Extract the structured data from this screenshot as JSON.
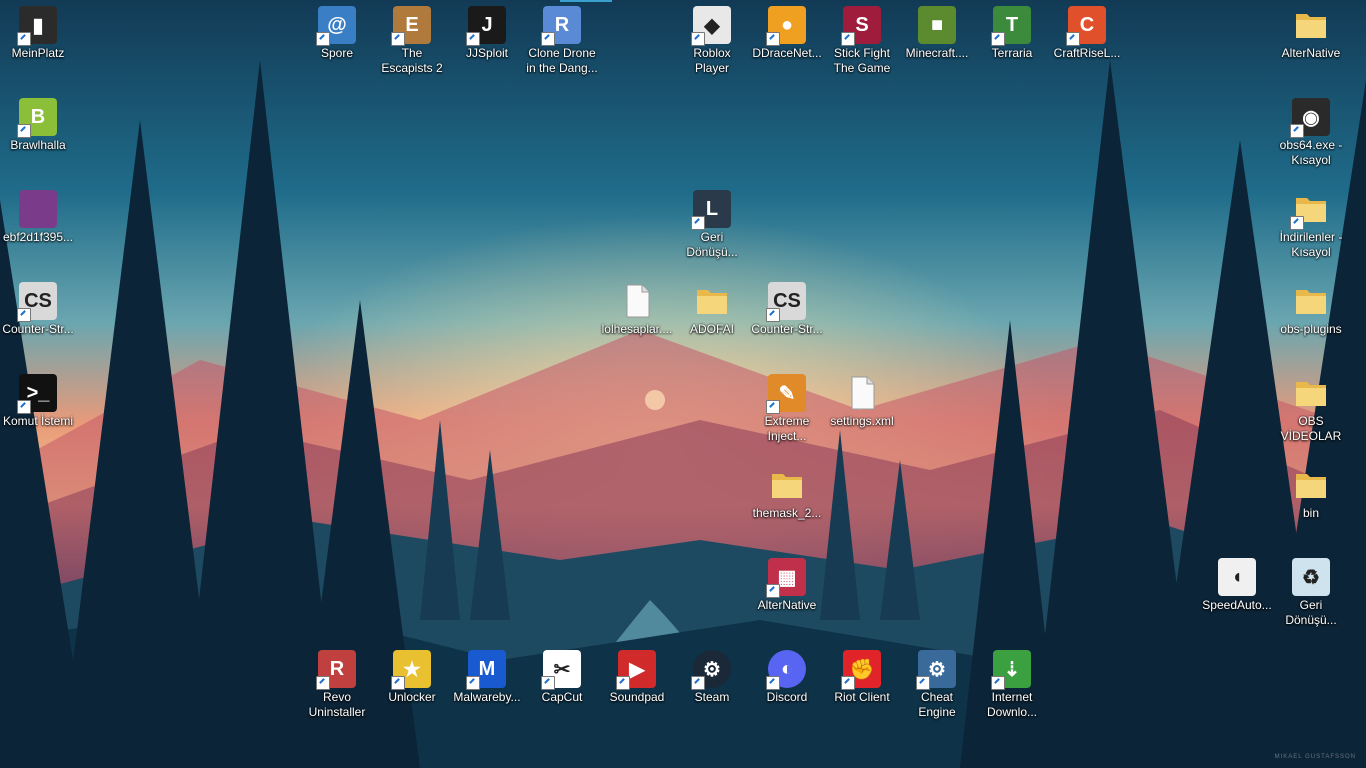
{
  "desktop": {
    "icons": [
      {
        "label": "MeinPlatz",
        "glyph": "▮",
        "color": "#2b2b2b",
        "shortcut": true
      },
      {
        "label": "Brawlhalla",
        "glyph": "B",
        "color": "#8bbf3a",
        "shortcut": true
      },
      {
        "label": "ebf2d1f395...",
        "glyph": "",
        "color": "#7a3c8a",
        "shortcut": false
      },
      {
        "label": "Counter-Str...",
        "glyph": "CS",
        "color": "#d9d9d9",
        "shortcut": true
      },
      {
        "label": "Komut İstemi",
        "glyph": ">_",
        "color": "#111111",
        "shortcut": true
      },
      {
        "label": "Spore",
        "glyph": "@",
        "color": "#3a7fc6",
        "shortcut": true
      },
      {
        "label": "The Escapists 2",
        "glyph": "E",
        "color": "#b07a3c",
        "shortcut": true
      },
      {
        "label": "JJSploit",
        "glyph": "J",
        "color": "#1a1a1a",
        "shortcut": true
      },
      {
        "label": "Clone Drone in the Dang...",
        "glyph": "R",
        "color": "#5a8ad6",
        "shortcut": true
      },
      {
        "label": "Roblox Player",
        "glyph": "◆",
        "color": "#e8e8e8",
        "shortcut": true
      },
      {
        "label": "DDraceNet...",
        "glyph": "●",
        "color": "#f0a020",
        "shortcut": true
      },
      {
        "label": "Stick Fight The Game",
        "glyph": "S",
        "color": "#a01c3c",
        "shortcut": true
      },
      {
        "label": "Minecraft....",
        "glyph": "■",
        "color": "#5c8a2e",
        "shortcut": false
      },
      {
        "label": "Terraria",
        "glyph": "T",
        "color": "#3c8a3c",
        "shortcut": true
      },
      {
        "label": "CraftRiseL...",
        "glyph": "C",
        "color": "#e0502a",
        "shortcut": true
      },
      {
        "label": "AlterNative",
        "glyph": "",
        "color": "#f2d27a",
        "shortcut": false
      },
      {
        "label": "obs64.exe - Kısayol",
        "glyph": "◉",
        "color": "#2a2a2a",
        "shortcut": true
      },
      {
        "label": "İndirilenler - Kısayol",
        "glyph": "↓",
        "color": "#f2d27a",
        "shortcut": true
      },
      {
        "label": "obs-plugins",
        "glyph": "",
        "color": "#f2d27a",
        "shortcut": false
      },
      {
        "label": "OBS VİDEOLAR",
        "glyph": "",
        "color": "#f2d27a",
        "shortcut": false
      },
      {
        "label": "bin",
        "glyph": "",
        "color": "#f2d27a",
        "shortcut": false
      },
      {
        "label": "SpeedAuto...",
        "glyph": "◖",
        "color": "#f0f0f0",
        "shortcut": false
      },
      {
        "label": "Geri Dönüşü...",
        "glyph": "♻",
        "color": "#cfe3ef",
        "shortcut": false
      },
      {
        "label": "Geri Dönüşü...",
        "glyph": "L",
        "color": "#2a3a4a",
        "shortcut": true
      },
      {
        "label": "lolhesaplar....",
        "glyph": "≡",
        "color": "#f4f4f4",
        "shortcut": false
      },
      {
        "label": "ADOFAI",
        "glyph": "",
        "color": "#f2d27a",
        "shortcut": false
      },
      {
        "label": "Counter-Str...",
        "glyph": "CS",
        "color": "#d9d9d9",
        "shortcut": true
      },
      {
        "label": "Extreme Inject...",
        "glyph": "✎",
        "color": "#e08a2a",
        "shortcut": true
      },
      {
        "label": "settings.xml",
        "glyph": "",
        "color": "#f4f4f4",
        "shortcut": false
      },
      {
        "label": "themask_2...",
        "glyph": "",
        "color": "#f2d27a",
        "shortcut": false
      },
      {
        "label": "AlterNative",
        "glyph": "▦",
        "color": "#c0304a",
        "shortcut": true
      },
      {
        "label": "Revo Uninstaller",
        "glyph": "R",
        "color": "#c04040",
        "shortcut": true
      },
      {
        "label": "Unlocker",
        "glyph": "★",
        "color": "#e8c030",
        "shortcut": true
      },
      {
        "label": "Malwareby...",
        "glyph": "M",
        "color": "#1a5ad0",
        "shortcut": true
      },
      {
        "label": "CapCut",
        "glyph": "✂",
        "color": "#ffffff",
        "shortcut": true
      },
      {
        "label": "Soundpad",
        "glyph": "▶",
        "color": "#d02a2a",
        "shortcut": true
      },
      {
        "label": "Steam",
        "glyph": "⚙",
        "color": "#1b2838",
        "shortcut": true
      },
      {
        "label": "Discord",
        "glyph": "◐",
        "color": "#5865f2",
        "shortcut": true
      },
      {
        "label": "Riot Client",
        "glyph": "✊",
        "color": "#e0242a",
        "shortcut": true
      },
      {
        "label": "Cheat Engine",
        "glyph": "⚙",
        "color": "#3a6a9a",
        "shortcut": true
      },
      {
        "label": "Internet Downlo...",
        "glyph": "⇣",
        "color": "#3aa040",
        "shortcut": true
      }
    ]
  },
  "watermark": "MIKAEL GUSTAFSSON"
}
